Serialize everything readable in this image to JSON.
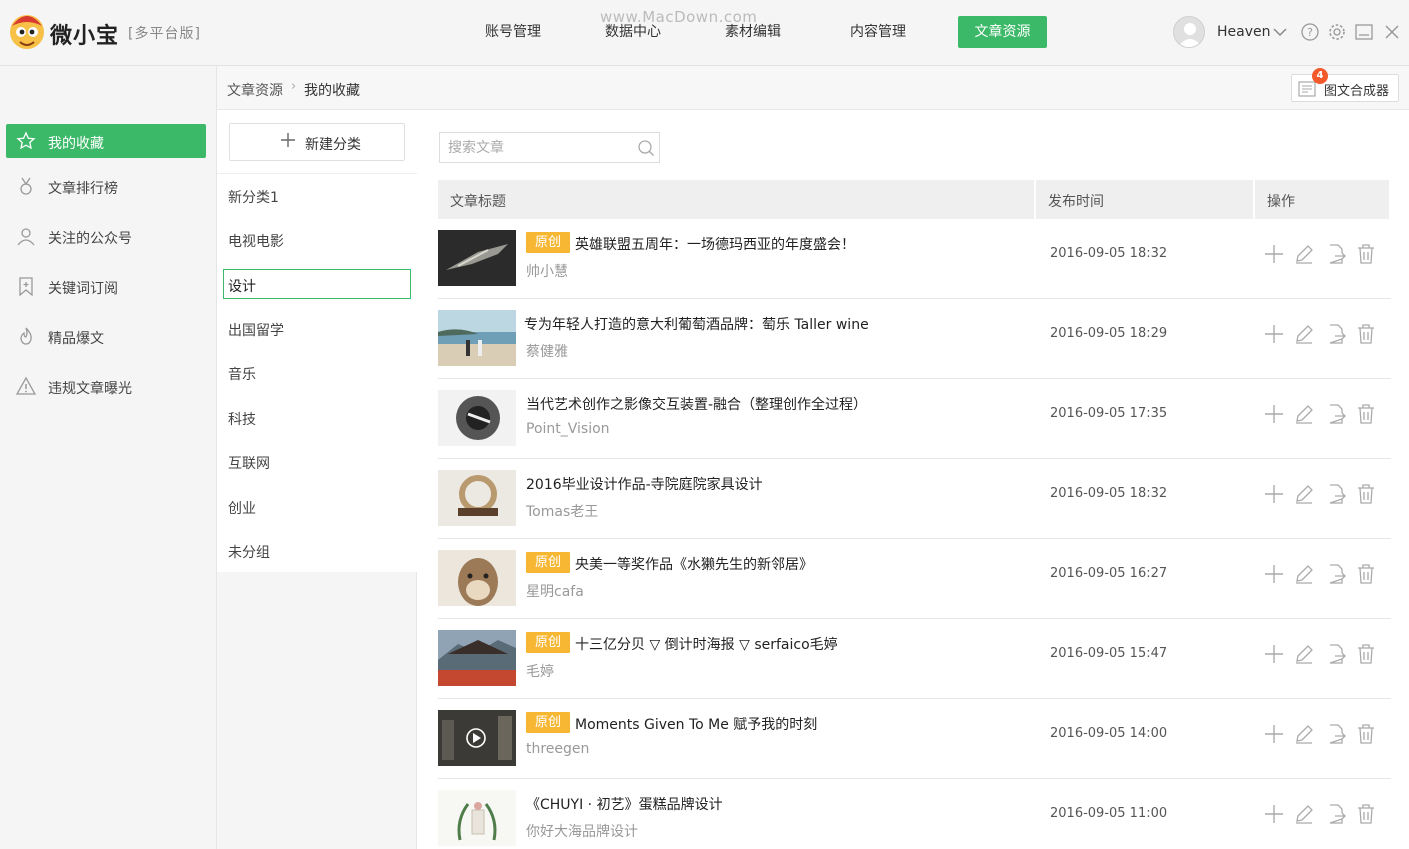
{
  "app": {
    "brand": "微小宝",
    "edition": "[多平台版]",
    "watermark": "www.MacDown.com"
  },
  "nav": [
    {
      "label": "账号管理"
    },
    {
      "label": "数据中心"
    },
    {
      "label": "素材编辑"
    },
    {
      "label": "内容管理"
    },
    {
      "label": "文章资源",
      "active": true
    }
  ],
  "user": {
    "name": "Heaven"
  },
  "breadcrumb": {
    "root": "文章资源",
    "current": "我的收藏"
  },
  "composer": {
    "label": "图文合成器",
    "badge": "4"
  },
  "sidebar": {
    "items": [
      {
        "label": "我的收藏",
        "icon": "star-icon",
        "active": true
      },
      {
        "label": "文章排行榜",
        "icon": "medal-icon"
      },
      {
        "label": "关注的公众号",
        "icon": "user-icon"
      },
      {
        "label": "关键词订阅",
        "icon": "bookmark-plus-icon"
      },
      {
        "label": "精品爆文",
        "icon": "flame-icon"
      },
      {
        "label": "违规文章曝光",
        "icon": "warning-icon"
      }
    ]
  },
  "categories": {
    "new_label": "新建分类",
    "items": [
      {
        "label": "新分类1"
      },
      {
        "label": "电视电影"
      },
      {
        "label": "设计",
        "selected": true
      },
      {
        "label": "出国留学"
      },
      {
        "label": "音乐"
      },
      {
        "label": "科技"
      },
      {
        "label": "互联网"
      },
      {
        "label": "创业"
      },
      {
        "label": "未分组"
      }
    ]
  },
  "search": {
    "placeholder": "搜索文章"
  },
  "table": {
    "headers": {
      "title": "文章标题",
      "date": "发布时间",
      "actions": "操作"
    },
    "tag_label": "原创",
    "rows": [
      {
        "original": true,
        "title": "英雄联盟五周年：一场德玛西亚的年度盛会！",
        "author": "帅小慧",
        "date": "2016-09-05 18:32"
      },
      {
        "original": false,
        "title": "专为年轻人打造的意大利葡萄酒品牌：萄乐 Taller wine",
        "author": "蔡健雅",
        "date": "2016-09-05 18:29"
      },
      {
        "original": false,
        "title": "当代艺术创作之影像交互装置-融合（整理创作全过程）",
        "author": "Point_Vision",
        "date": "2016-09-05 17:35"
      },
      {
        "original": false,
        "title": "2016毕业设计作品-寺院庭院家具设计",
        "author": "Tomas老王",
        "date": "2016-09-05 18:32"
      },
      {
        "original": true,
        "title": "央美一等奖作品《水獭先生的新邻居》",
        "author": "星明cafa",
        "date": "2016-09-05 16:27"
      },
      {
        "original": true,
        "title": "十三亿分贝 ▽ 倒计时海报 ▽ serfaico毛婷",
        "author": "毛婷",
        "date": "2016-09-05 15:47"
      },
      {
        "original": true,
        "title": "Moments Given To Me 赋予我的时刻",
        "author": "threegen",
        "date": "2016-09-05 14:00"
      },
      {
        "original": false,
        "title": "《CHUYI · 初艺》蛋糕品牌设计",
        "author": "你好大海品牌设计",
        "date": "2016-09-05 11:00"
      }
    ]
  },
  "colors": {
    "accent": "#3cb968",
    "tag": "#f7b733",
    "badge": "#f25a2b"
  }
}
